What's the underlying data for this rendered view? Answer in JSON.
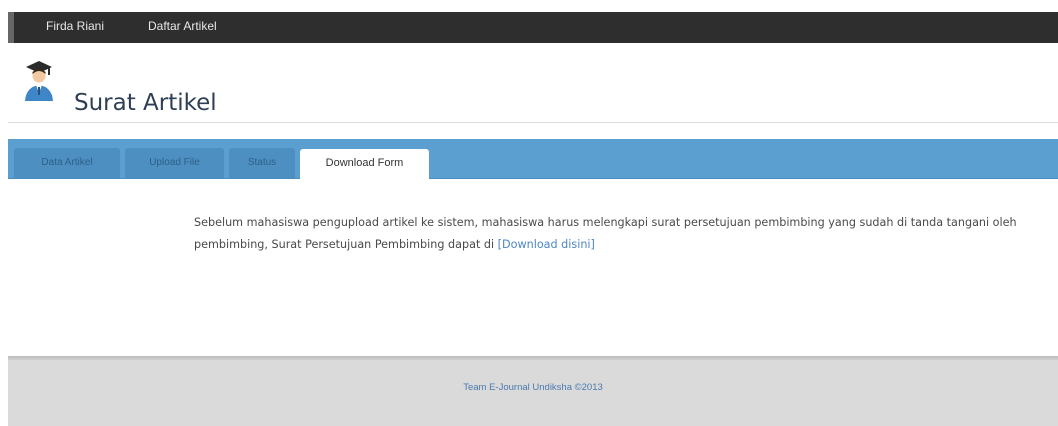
{
  "topnav": {
    "items": [
      {
        "label": "Firda Riani"
      },
      {
        "label": "Daftar Artikel"
      }
    ]
  },
  "header": {
    "title": "Surat Artikel",
    "icon": "graduate-user-icon"
  },
  "tabs": [
    {
      "label": "Data Artikel",
      "active": false
    },
    {
      "label": "Upload File",
      "active": false
    },
    {
      "label": "Status",
      "active": false
    },
    {
      "label": "Download Form",
      "active": true
    }
  ],
  "content": {
    "text_before_bold": "Sebelum mahasiswa pengupload artikel ke sistem, mahasiswa harus melengkapi surat persetujuan pembimbing yang sudah di tanda tangani oleh pembimbing, ",
    "bold_text": "Surat Persetujuan Pembimbing",
    "text_after_bold": " dapat di ",
    "link_label": "[Download disini]"
  },
  "footer": {
    "text": "Team E-Journal Undiksha ©2013"
  },
  "colors": {
    "topbar": "#2e2e2e",
    "tabbar": "#5b9fd0",
    "link": "#4d86c5",
    "footer": "#dadada"
  }
}
